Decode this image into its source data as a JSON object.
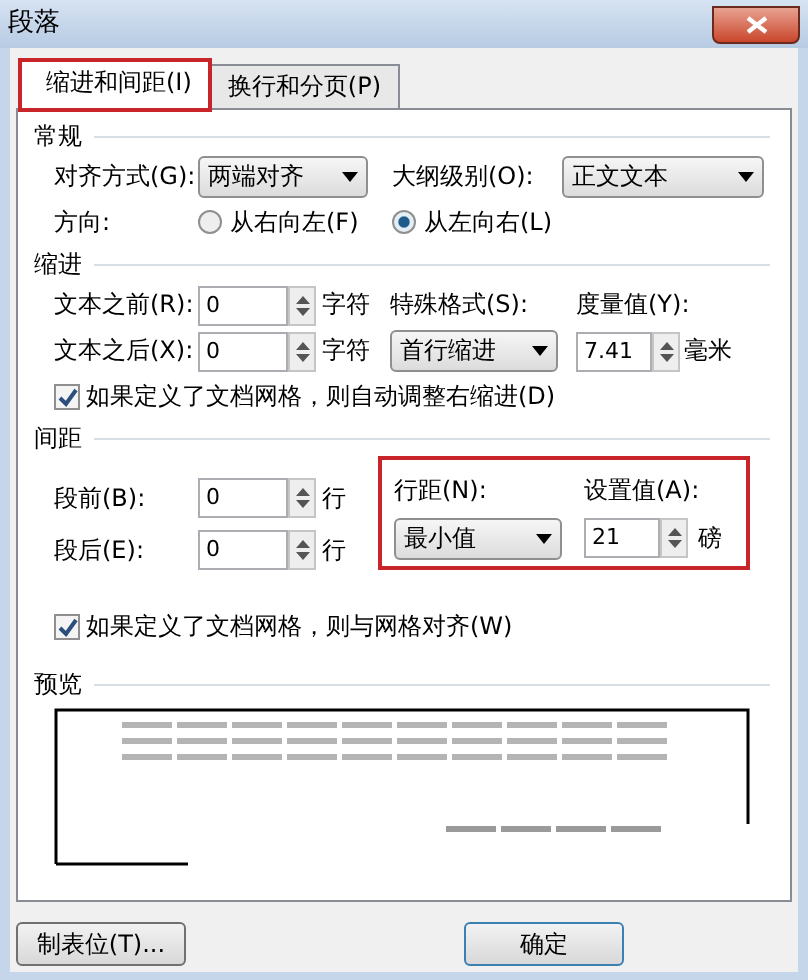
{
  "window": {
    "title": "段落"
  },
  "tabs": [
    {
      "label": "缩进和间距(I)",
      "selected": true,
      "highlighted": true
    },
    {
      "label": "换行和分页(P)",
      "selected": false,
      "highlighted": false
    }
  ],
  "general": {
    "heading": "常规",
    "alignment": {
      "label": "对齐方式(G):",
      "value": "两端对齐"
    },
    "outline_level": {
      "label": "大纲级别(O):",
      "value": "正文文本"
    },
    "direction": {
      "label": "方向:",
      "options": [
        {
          "label": "从右向左(F)",
          "selected": false
        },
        {
          "label": "从左向右(L)",
          "selected": true
        }
      ]
    }
  },
  "indent": {
    "heading": "缩进",
    "before": {
      "label": "文本之前(R):",
      "value": "0",
      "unit": "字符"
    },
    "after": {
      "label": "文本之后(X):",
      "value": "0",
      "unit": "字符"
    },
    "special": {
      "label": "特殊格式(S):",
      "value": "首行缩进"
    },
    "by": {
      "label": "度量值(Y):",
      "value": "7.41",
      "unit": "毫米"
    },
    "checkbox": {
      "label": "如果定义了文档网格，则自动调整右缩进(D)",
      "checked": true
    }
  },
  "spacing": {
    "heading": "间距",
    "before": {
      "label": "段前(B):",
      "value": "0",
      "unit": "行"
    },
    "after": {
      "label": "段后(E):",
      "value": "0",
      "unit": "行"
    },
    "line_group": {
      "highlighted": true,
      "line_spacing": {
        "label": "行距(N):",
        "value": "最小值"
      },
      "at": {
        "label": "设置值(A):",
        "value": "21",
        "unit": "磅"
      }
    },
    "checkbox": {
      "label": "如果定义了文档网格，则与网格对齐(W)",
      "checked": true
    }
  },
  "preview": {
    "heading": "预览"
  },
  "buttons": [
    {
      "label": "制表位(T)..."
    },
    {
      "label": "确定"
    }
  ]
}
